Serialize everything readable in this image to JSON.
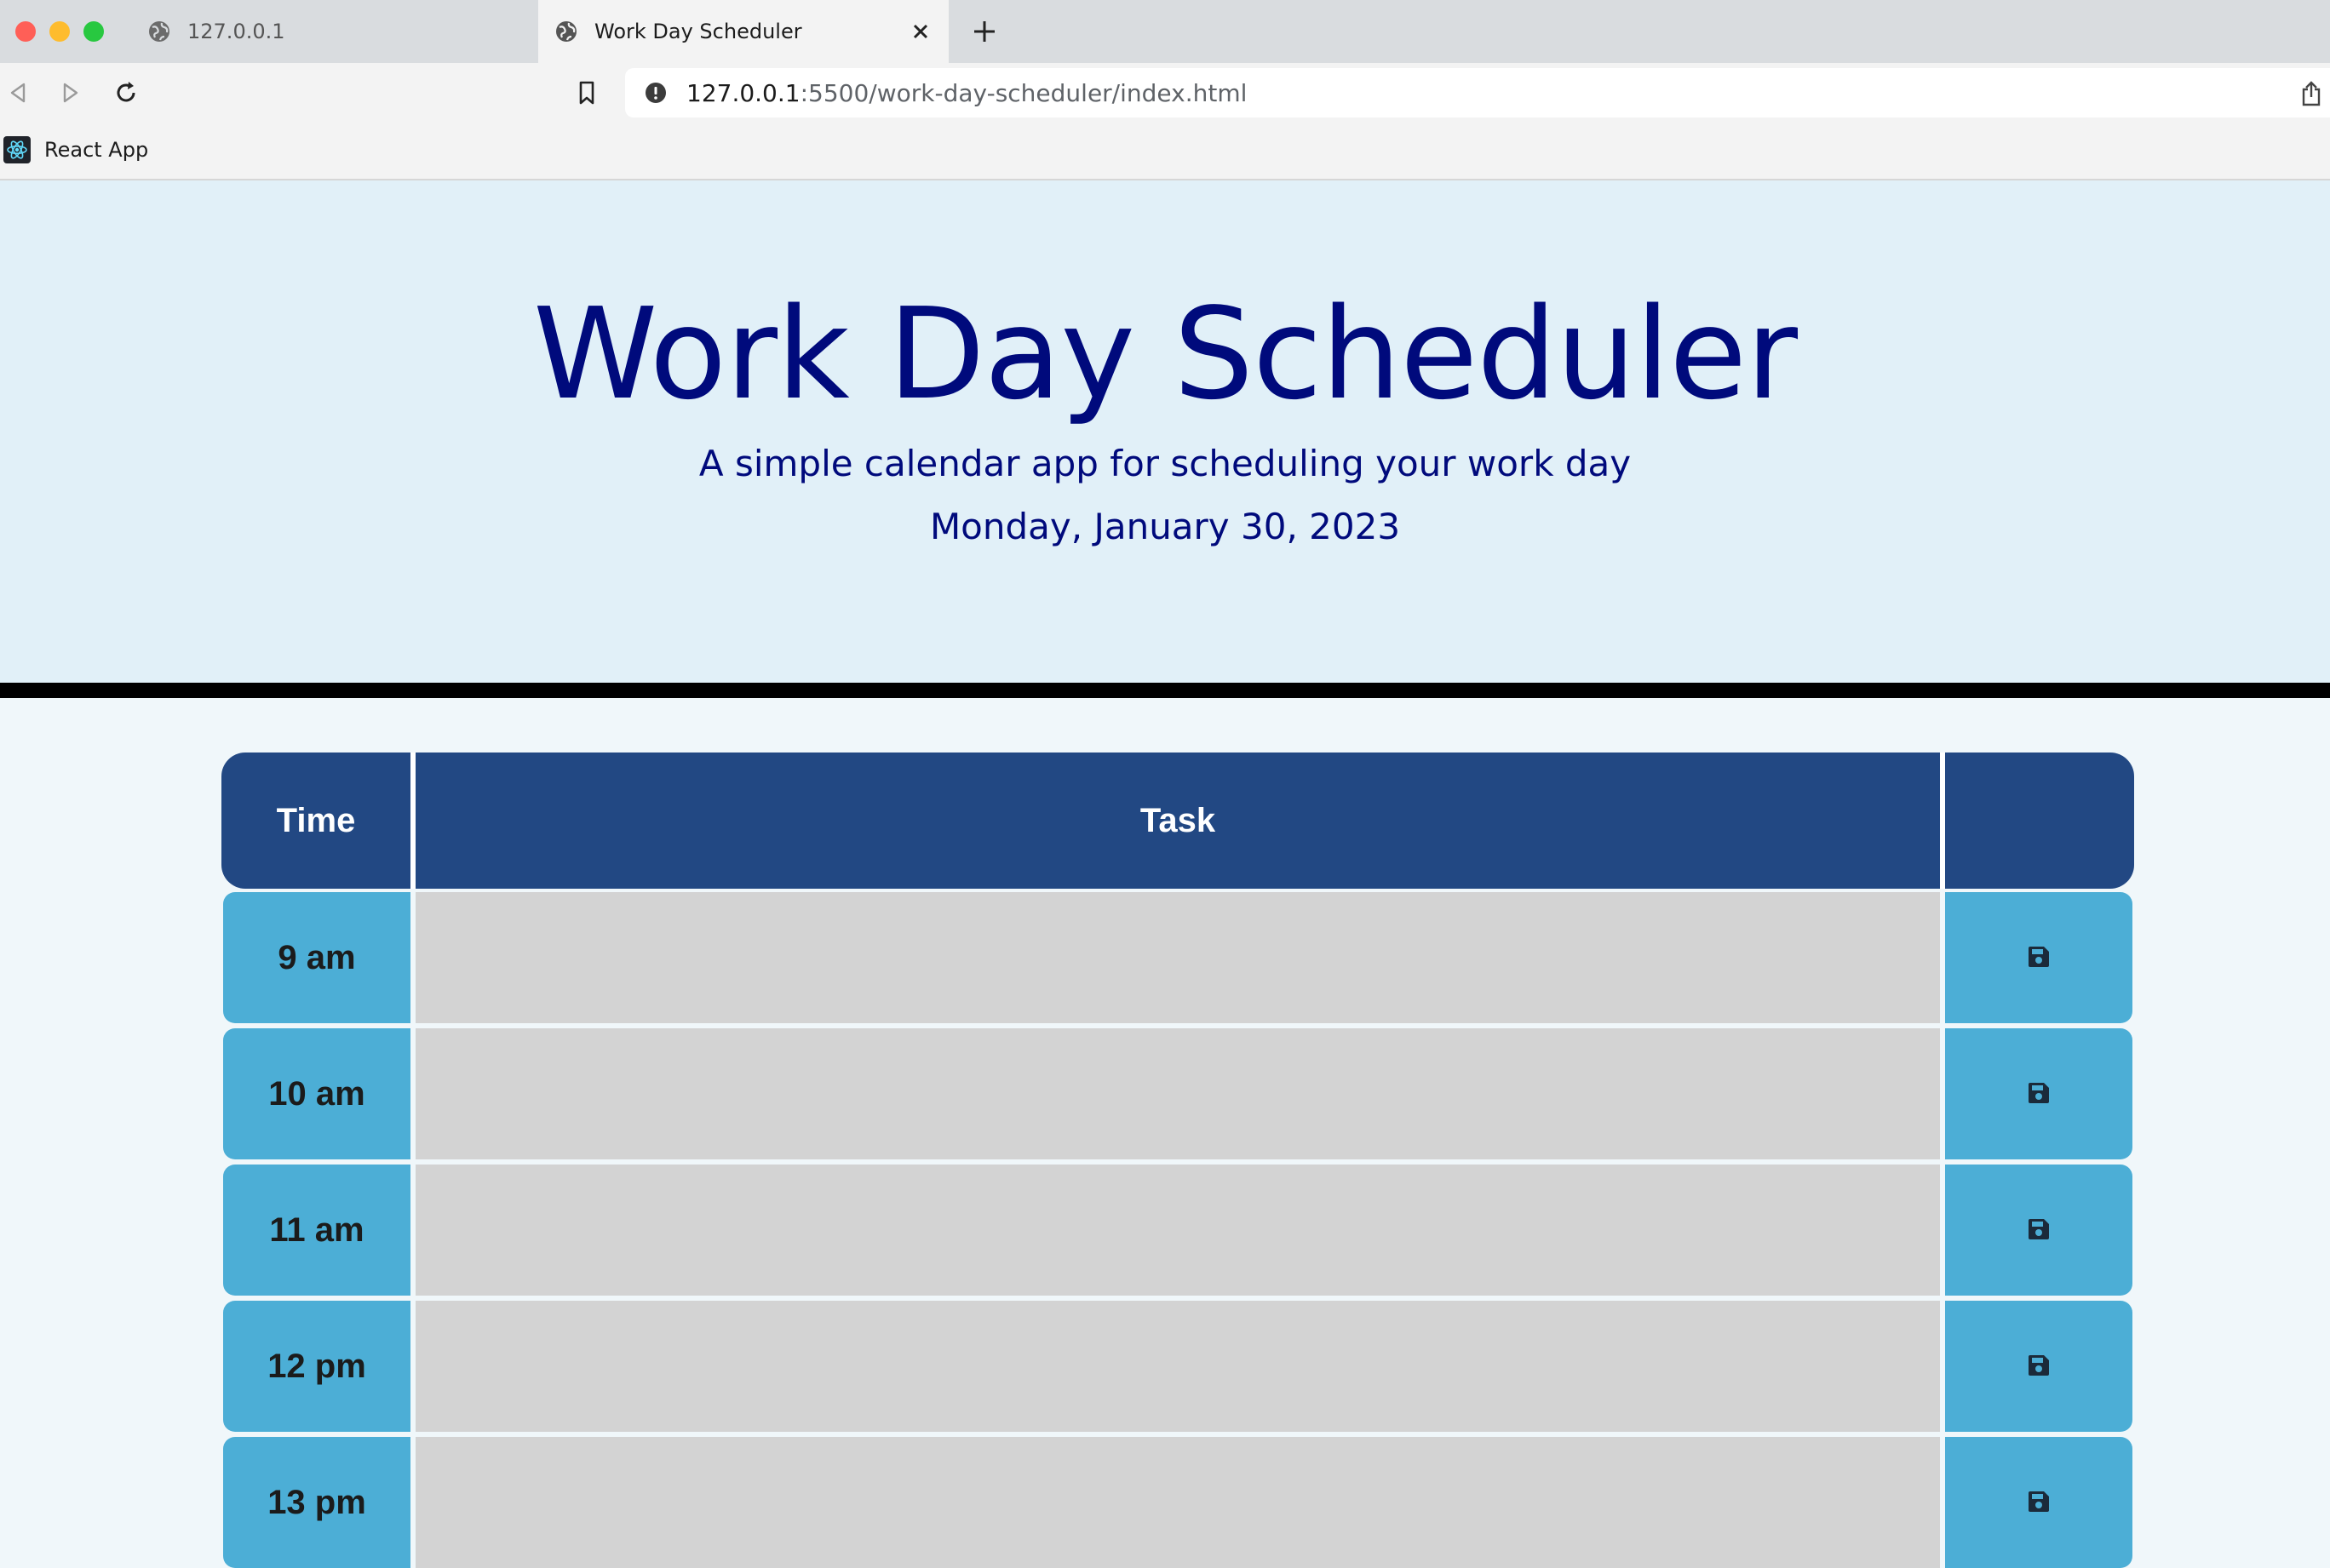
{
  "browser": {
    "tabs": [
      {
        "title": "127.0.0.1",
        "active": false
      },
      {
        "title": "Work Day Scheduler",
        "active": true
      }
    ],
    "address": {
      "host": "127.0.0.1",
      "path": ":5500/work-day-scheduler/index.html"
    },
    "bookmarks": [
      {
        "label": "React App"
      }
    ]
  },
  "header": {
    "title": "Work Day Scheduler",
    "subtitle": "A simple calendar app for scheduling your work day",
    "date": "Monday, January 30, 2023"
  },
  "table": {
    "columns": {
      "time": "Time",
      "task": "Task",
      "save": ""
    },
    "rows": [
      {
        "time": "9 am",
        "task": ""
      },
      {
        "time": "10 am",
        "task": ""
      },
      {
        "time": "11 am",
        "task": ""
      },
      {
        "time": "12 pm",
        "task": ""
      },
      {
        "time": "13 pm",
        "task": ""
      }
    ]
  },
  "colors": {
    "title": "#000a7c",
    "jumbotron_bg": "#e1f0f8",
    "header_bg": "#224883",
    "time_cell_bg": "#4caed6",
    "task_cell_bg": "#d3d3d3",
    "save_bg": "#4caed6"
  }
}
